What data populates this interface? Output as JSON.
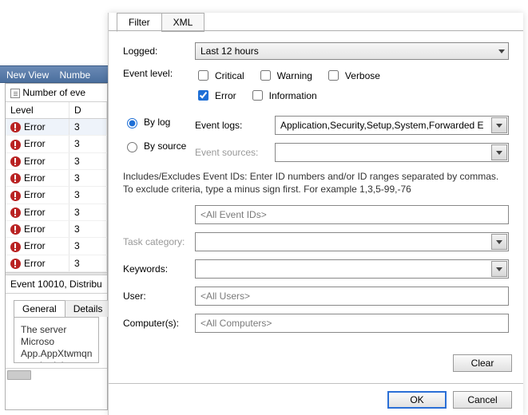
{
  "background": {
    "toolbar": {
      "new_view": "New View",
      "numbe": "Numbe"
    },
    "filter_row": "Number of eve",
    "grid": {
      "headers": {
        "level": "Level",
        "d": "D"
      },
      "rows": [
        {
          "level": "Error",
          "d": "3",
          "selected": true
        },
        {
          "level": "Error",
          "d": "3"
        },
        {
          "level": "Error",
          "d": "3"
        },
        {
          "level": "Error",
          "d": "3"
        },
        {
          "level": "Error",
          "d": "3"
        },
        {
          "level": "Error",
          "d": "3"
        },
        {
          "level": "Error",
          "d": "3"
        },
        {
          "level": "Error",
          "d": "3"
        },
        {
          "level": "Error",
          "d": "3"
        }
      ]
    },
    "detail_header": "Event 10010, Distribu",
    "detail_tabs": {
      "general": "General",
      "details": "Details"
    },
    "detail_body": "The server Microso\nApp.AppXtwmqn\nrequired timeout"
  },
  "dialog": {
    "tabs": {
      "filter": "Filter",
      "xml": "XML"
    },
    "logged": {
      "label": "Logged:",
      "value": "Last 12 hours"
    },
    "event_level": {
      "label": "Event level:",
      "options": {
        "critical": {
          "label": "Critical",
          "checked": false
        },
        "warning": {
          "label": "Warning",
          "checked": false
        },
        "verbose": {
          "label": "Verbose",
          "checked": false
        },
        "error": {
          "label": "Error",
          "checked": true
        },
        "information": {
          "label": "Information",
          "checked": false
        }
      }
    },
    "mode": {
      "by_log": {
        "label": "By log",
        "checked": true
      },
      "by_source": {
        "label": "By source",
        "checked": false
      }
    },
    "event_logs": {
      "label": "Event logs:",
      "value": "Application,Security,Setup,System,Forwarded E"
    },
    "event_sources": {
      "label": "Event sources:",
      "value": ""
    },
    "help": "Includes/Excludes Event IDs: Enter ID numbers and/or ID ranges separated by commas. To exclude criteria, type a minus sign first. For example 1,3,5-99,-76",
    "event_ids": {
      "placeholder": "<All Event IDs>"
    },
    "task_category": {
      "label": "Task category:",
      "value": ""
    },
    "keywords": {
      "label": "Keywords:",
      "value": ""
    },
    "user": {
      "label": "User:",
      "value": "<All Users>"
    },
    "computers": {
      "label": "Computer(s):",
      "value": "<All Computers>"
    },
    "clear": "Clear",
    "ok": "OK",
    "cancel": "Cancel"
  }
}
